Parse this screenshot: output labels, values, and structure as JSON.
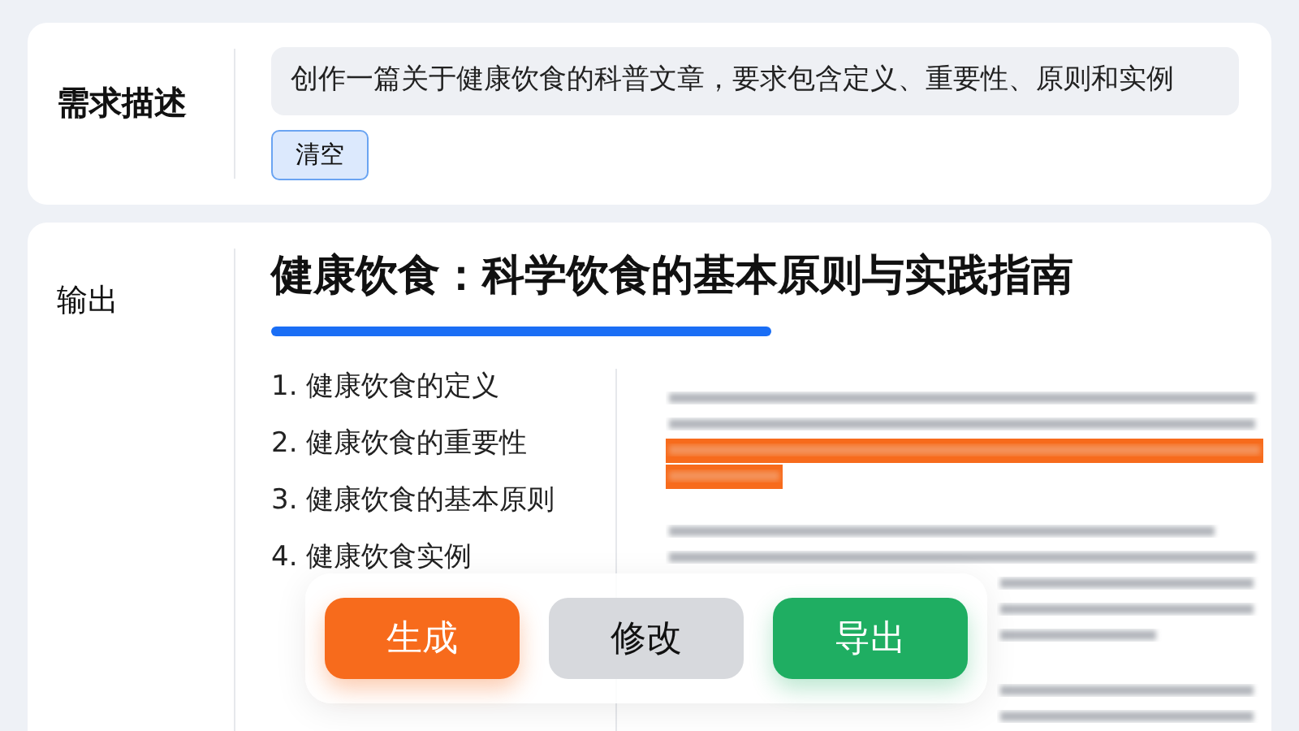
{
  "request": {
    "label": "需求描述",
    "value": "创作一篇关于健康饮食的科普文章，要求包含定义、重要性、原则和实例",
    "clear_button": "清空"
  },
  "output": {
    "label": "输出",
    "title": "健康饮食：科学饮食的基本原则与实践指南",
    "outline": [
      "1. 健康饮食的定义",
      "2. 健康饮食的重要性",
      "3. 健康饮食的基本原则",
      "4. 健康饮食实例"
    ]
  },
  "actions": [
    {
      "label": "生成",
      "kind": "primary"
    },
    {
      "label": "修改",
      "kind": "secondary"
    },
    {
      "label": "导出",
      "kind": "success"
    }
  ]
}
